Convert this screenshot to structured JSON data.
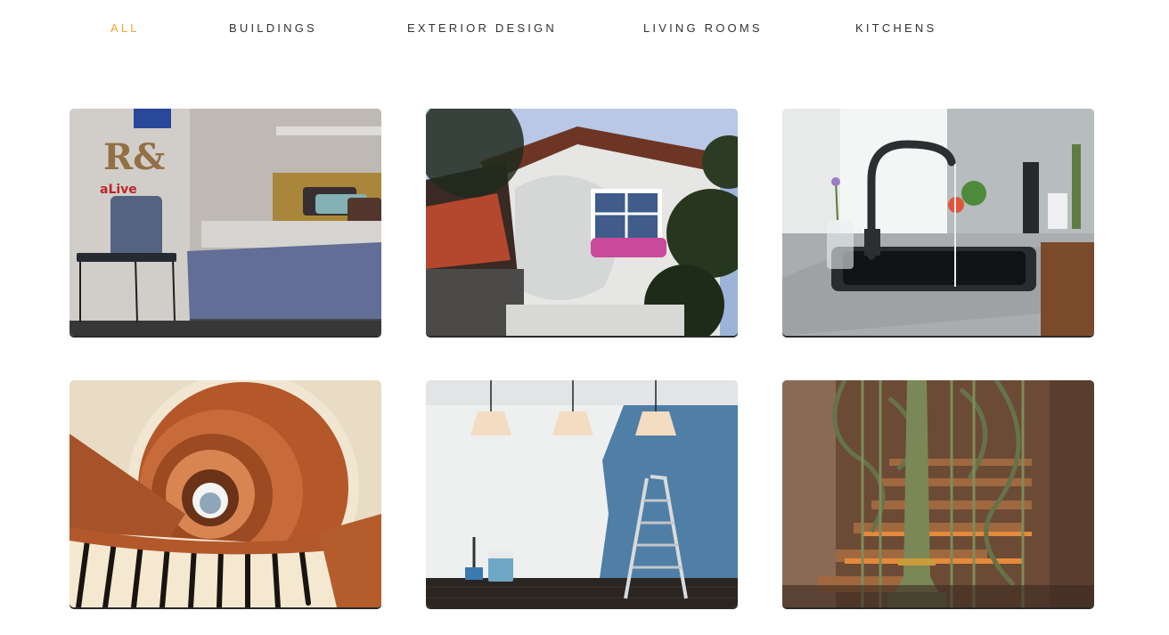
{
  "filters": {
    "active_color": "#e8a63a",
    "items": [
      {
        "label": "ALL",
        "active": true
      },
      {
        "label": "BUILDINGS",
        "active": false
      },
      {
        "label": "EXTERIOR DESIGN",
        "active": false
      },
      {
        "label": "LIVING ROOMS",
        "active": false
      },
      {
        "label": "KITCHENS",
        "active": false
      }
    ]
  },
  "gallery": {
    "items": [
      {
        "name": "bedroom-photo",
        "wall_letters": "R&"
      },
      {
        "name": "ornate-building-facade-photo"
      },
      {
        "name": "kitchen-sink-faucet-photo"
      },
      {
        "name": "spiral-staircase-photo"
      },
      {
        "name": "painted-wall-ladder-photo"
      },
      {
        "name": "green-iron-staircase-photo"
      }
    ]
  }
}
